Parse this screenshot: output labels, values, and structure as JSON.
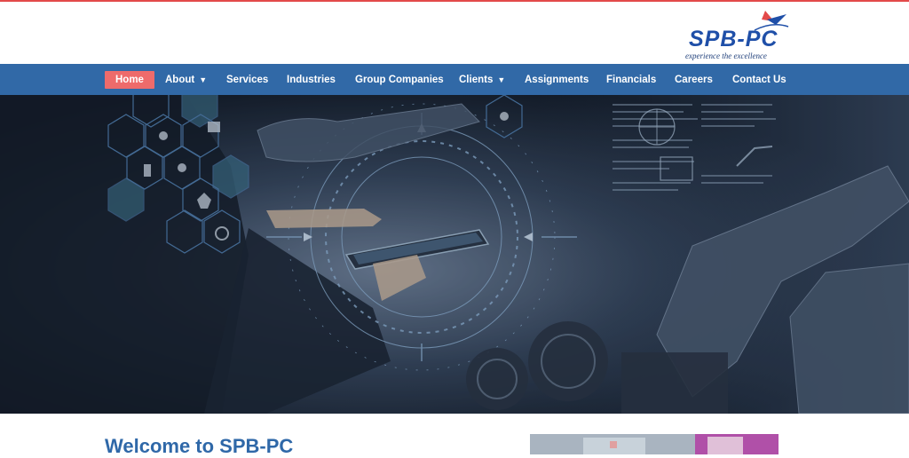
{
  "brand": {
    "name": "SPB-PC",
    "tagline": "experience the excellence",
    "accent_red": "#e34a4a",
    "accent_blue": "#1f4fa8"
  },
  "nav": {
    "background": "#3169a7",
    "active_color": "#ee6b6b",
    "items": [
      {
        "label": "Home",
        "active": true
      },
      {
        "label": "About",
        "has_dropdown": true
      },
      {
        "label": "Services"
      },
      {
        "label": "Industries"
      },
      {
        "label": "Group Companies"
      },
      {
        "label": "Clients",
        "has_dropdown": true
      },
      {
        "label": "Assignments"
      },
      {
        "label": "Financials"
      },
      {
        "label": "Careers"
      },
      {
        "label": "Contact Us"
      }
    ]
  },
  "hero": {
    "image_subject": "industrial automation banner"
  },
  "main": {
    "welcome_heading": "Welcome to SPB-PC"
  }
}
